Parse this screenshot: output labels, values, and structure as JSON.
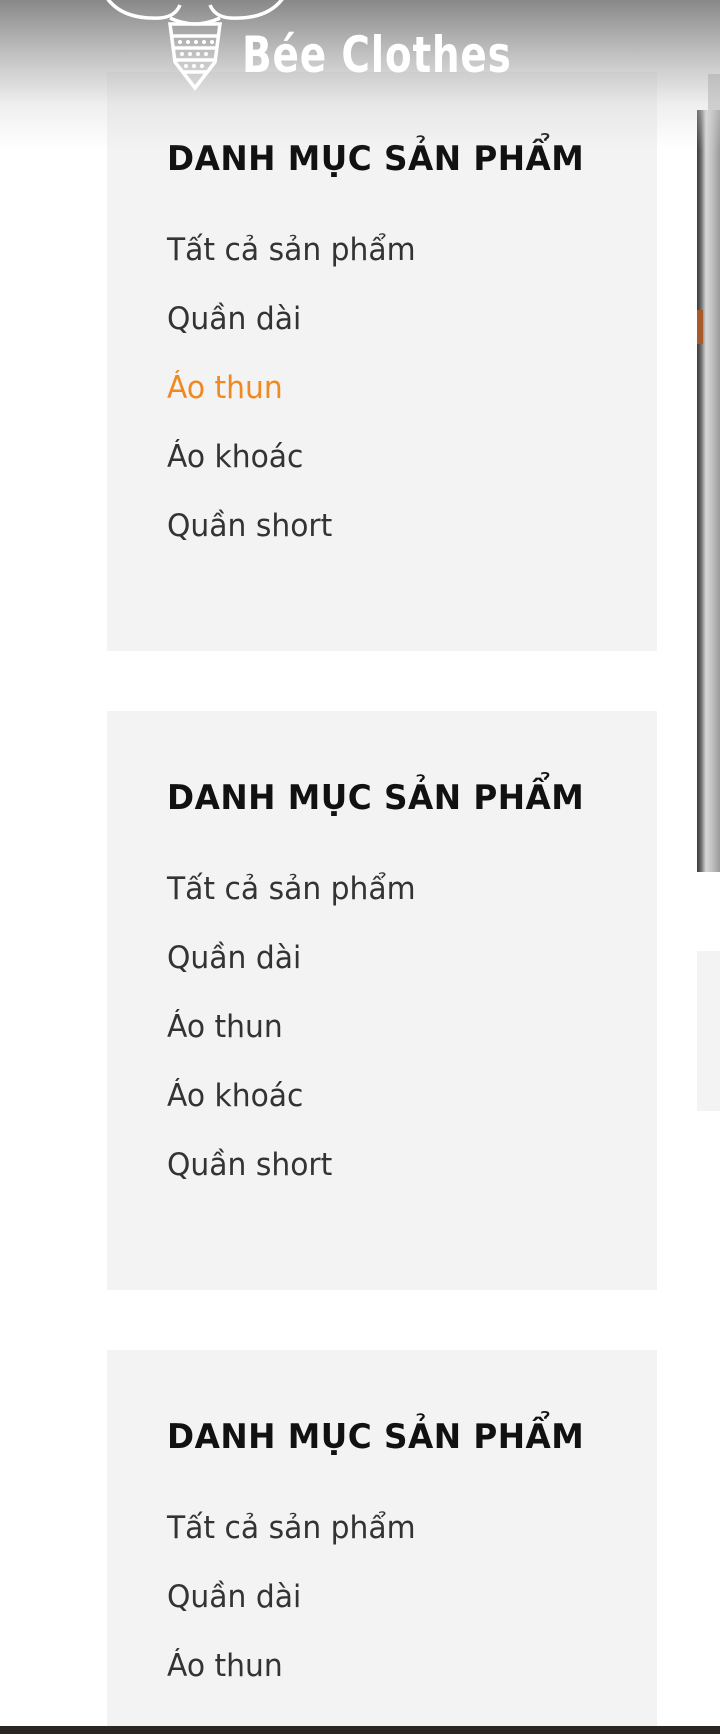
{
  "brand": {
    "logo_text": "Bée Clothes",
    "logo_icon": "bee-icon"
  },
  "colors": {
    "active_link": "#ef8a22",
    "text": "#333333",
    "title": "#111111",
    "panel_bg": "#f3f3f3"
  },
  "panels": [
    {
      "title": "DANH MỤC SẢN PHẨM",
      "items": [
        {
          "label": "Tất cả sản phẩm",
          "active": false
        },
        {
          "label": "Quần dài",
          "active": false
        },
        {
          "label": "Áo thun",
          "active": true
        },
        {
          "label": "Áo khoác",
          "active": false
        },
        {
          "label": "Quần short",
          "active": false
        }
      ]
    },
    {
      "title": "DANH MỤC SẢN PHẨM",
      "items": [
        {
          "label": "Tất cả sản phẩm",
          "active": false
        },
        {
          "label": "Quần dài",
          "active": false
        },
        {
          "label": "Áo thun",
          "active": false
        },
        {
          "label": "Áo khoác",
          "active": false
        },
        {
          "label": "Quần short",
          "active": false
        }
      ]
    },
    {
      "title": "DANH MỤC SẢN PHẨM",
      "items": [
        {
          "label": "Tất cả sản phẩm",
          "active": false
        },
        {
          "label": "Quần dài",
          "active": false
        },
        {
          "label": "Áo thun",
          "active": false
        }
      ]
    }
  ]
}
